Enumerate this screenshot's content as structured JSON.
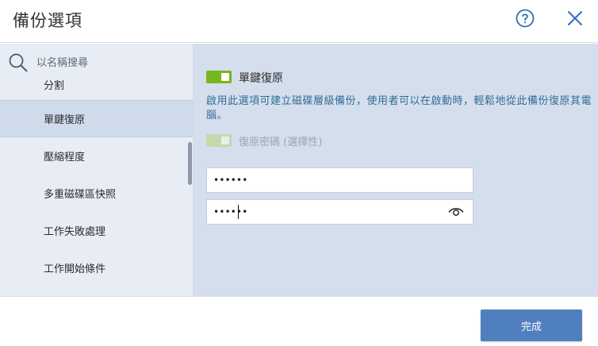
{
  "dialog": {
    "title": "備份選項",
    "help_icon": "help-circle-icon",
    "close_icon": "close-icon"
  },
  "sidebar": {
    "search_placeholder": "以名稱搜尋",
    "search_icon": "search-icon",
    "items": [
      {
        "label": "分割"
      },
      {
        "label": "單鍵復原",
        "active": true
      },
      {
        "label": "壓縮程度"
      },
      {
        "label": "多重磁碟區快照"
      },
      {
        "label": "工作失敗處理"
      },
      {
        "label": "工作開始條件"
      }
    ]
  },
  "content": {
    "one_click_toggle": {
      "label": "單鍵復原",
      "on": true
    },
    "description": "啟用此選項可建立磁碟層級備份，使用者可以在啟動時，輕鬆地從此備份復原其電腦。",
    "password_toggle": {
      "label": "復原密碼 (選擇性)",
      "on": true,
      "disabled": true
    },
    "password": "••••••",
    "password_confirm": "••••••",
    "eye_icon": "eye-icon"
  },
  "footer": {
    "done_label": "完成"
  },
  "colors": {
    "accent_green": "#74b81d",
    "primary_button": "#4f7fbf",
    "content_bg": "#d4deec",
    "sidebar_bg": "#e8edf5",
    "description_text": "#2f6d97"
  }
}
